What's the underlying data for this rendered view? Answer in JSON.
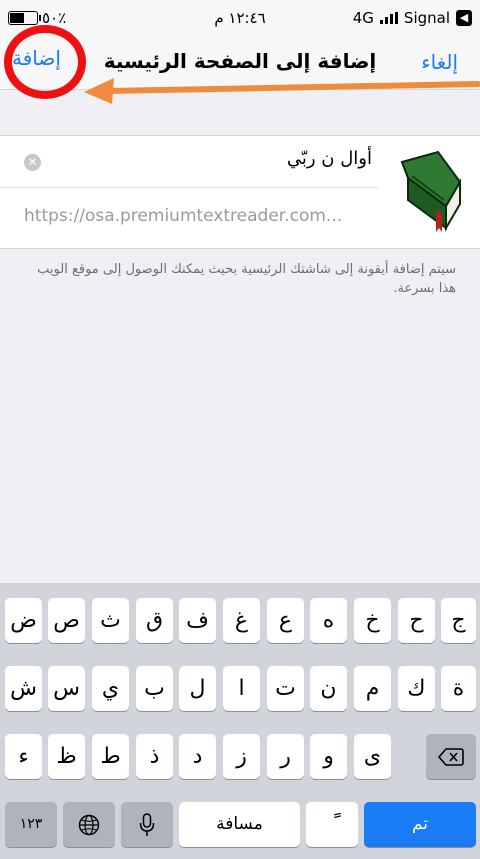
{
  "status_bar": {
    "battery": "٥٠٪",
    "time": "١٢:٤٦ م",
    "network": "4G",
    "carrier": "Signal"
  },
  "nav": {
    "add_label": "إضافة",
    "title": "إضافة إلى الصفحة الرئيسية",
    "cancel_label": "إلغاء"
  },
  "bookmark": {
    "name": "أوال ن ربّي",
    "url": "https://osa.premiumtextreader.com..."
  },
  "note": "سيتم إضافة أيقونة إلى شاشتك الرئيسية بحيث يمكنك الوصول إلى موقع الويب هذا بسرعة.",
  "keyboard": {
    "row1": [
      "ض",
      "ص",
      "ث",
      "ق",
      "ف",
      "غ",
      "ع",
      "ه",
      "خ",
      "ح",
      "ج"
    ],
    "row2": [
      "ش",
      "س",
      "ي",
      "ب",
      "ل",
      "ا",
      "ت",
      "ن",
      "م",
      "ك",
      "ة"
    ],
    "row3": [
      "ء",
      "ظ",
      "ط",
      "ذ",
      "د",
      "ز",
      "ر",
      "و",
      "ى"
    ],
    "numbers_label": "١٢٣",
    "space_label": "مسافة",
    "tanween_label": "ًً",
    "done_label": "تم"
  },
  "colors": {
    "accent": "#1a7cf5",
    "highlight_ring": "#ee1111",
    "arrow": "#f08a3c"
  }
}
